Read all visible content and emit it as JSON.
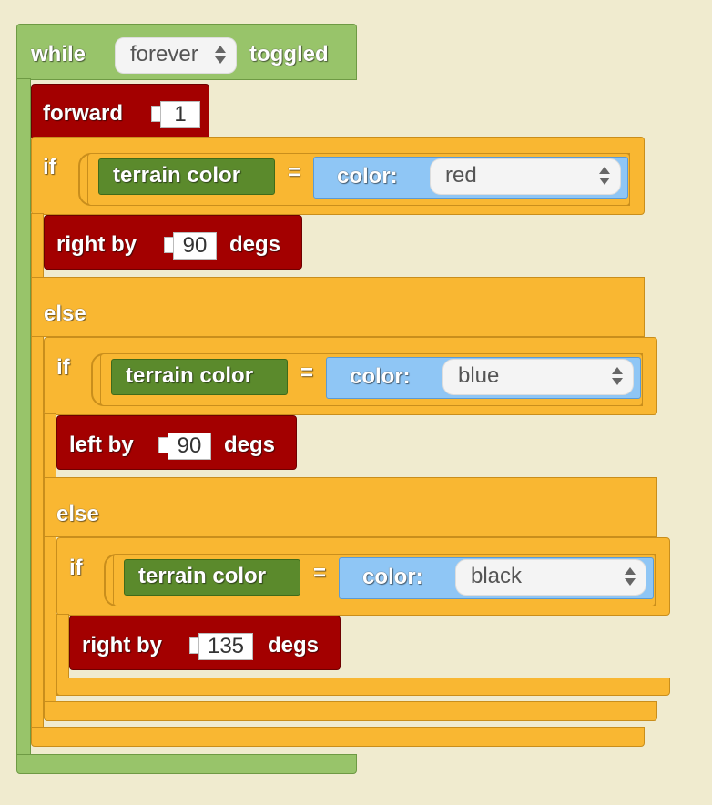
{
  "while_block": {
    "label": "while",
    "mode": "forever",
    "suffix": "toggled"
  },
  "forward_block": {
    "label": "forward",
    "value": "1"
  },
  "if1": {
    "label_if": "if",
    "sensor": "terrain color",
    "eq": "=",
    "color_label": "color:",
    "color": "red",
    "action_label": "right by",
    "action_value": "90",
    "action_unit": "degs",
    "label_else": "else"
  },
  "if2": {
    "label_if": "if",
    "sensor": "terrain color",
    "eq": "=",
    "color_label": "color:",
    "color": "blue",
    "action_label": "left by",
    "action_value": "90",
    "action_unit": "degs",
    "label_else": "else"
  },
  "if3": {
    "label_if": "if",
    "sensor": "terrain color",
    "eq": "=",
    "color_label": "color:",
    "color": "black",
    "action_label": "right by",
    "action_value": "135",
    "action_unit": "degs"
  },
  "colors": {
    "loop": "#98c46a",
    "logic": "#f9b732",
    "motion": "#a30000",
    "sensor": "#5b8a2c",
    "color_value": "#8fc6f5",
    "background": "#f0ebcf"
  }
}
